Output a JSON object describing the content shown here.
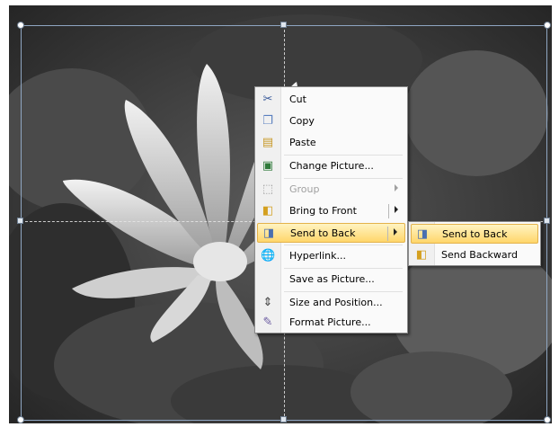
{
  "context_menu": {
    "items": [
      {
        "label": "Cut",
        "icon": "scissors-icon",
        "enabled": true,
        "submenu": false
      },
      {
        "label": "Copy",
        "icon": "copy-icon",
        "enabled": true,
        "submenu": false
      },
      {
        "label": "Paste",
        "icon": "paste-icon",
        "enabled": true,
        "submenu": false
      },
      {
        "label": "Change Picture...",
        "icon": "change-picture-icon",
        "enabled": true,
        "submenu": false
      },
      {
        "label": "Group",
        "icon": "group-icon",
        "enabled": false,
        "submenu": true
      },
      {
        "label": "Bring to Front",
        "icon": "bring-to-front-icon",
        "enabled": true,
        "submenu": true
      },
      {
        "label": "Send to Back",
        "icon": "send-to-back-icon",
        "enabled": true,
        "submenu": true,
        "highlighted": true
      },
      {
        "label": "Hyperlink...",
        "icon": "hyperlink-icon",
        "enabled": true,
        "submenu": false
      },
      {
        "label": "Save as Picture...",
        "icon": "save-icon",
        "enabled": true,
        "submenu": false
      },
      {
        "label": "Size and Position...",
        "icon": "size-position-icon",
        "enabled": true,
        "submenu": false
      },
      {
        "label": "Format Picture...",
        "icon": "format-picture-icon",
        "enabled": true,
        "submenu": false
      }
    ]
  },
  "submenu": {
    "items": [
      {
        "label": "Send to Back",
        "icon": "send-to-back-icon",
        "highlighted": true
      },
      {
        "label": "Send Backward",
        "icon": "send-backward-icon",
        "highlighted": false
      }
    ]
  },
  "colors": {
    "highlight_top": "#fff4c2",
    "highlight_bottom": "#ffd66b",
    "selection_frame": "#8fa6c2"
  }
}
